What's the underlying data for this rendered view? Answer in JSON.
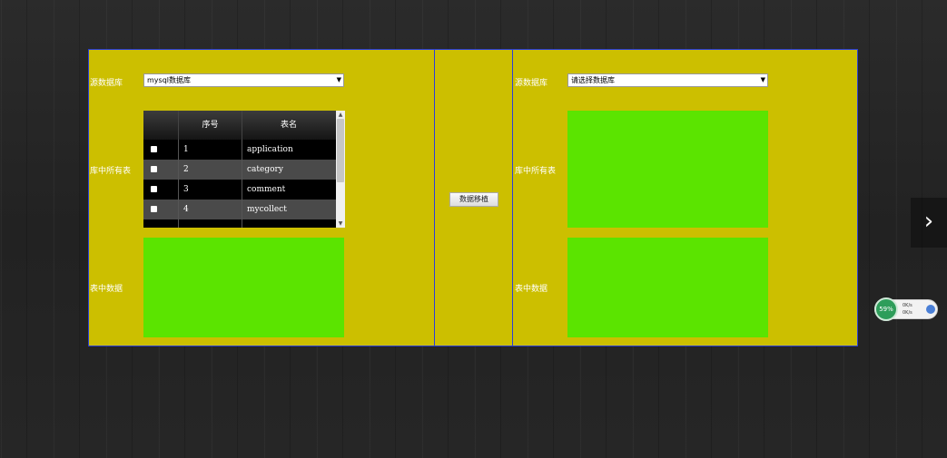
{
  "left": {
    "source_db_label": "源数据库",
    "source_db_value": "mysql数据库",
    "tables_label": "库中所有表",
    "data_label": "表中数据",
    "table": {
      "headers": [
        "",
        "序号",
        "表名"
      ],
      "rows": [
        {
          "num": "1",
          "name": "application"
        },
        {
          "num": "2",
          "name": "category"
        },
        {
          "num": "3",
          "name": "comment"
        },
        {
          "num": "4",
          "name": "mycollect"
        }
      ]
    }
  },
  "middle": {
    "migrate_button": "数据移植"
  },
  "right": {
    "target_db_label": "源数据库",
    "target_db_value": "请选择数据库",
    "tables_label": "库中所有表",
    "data_label": "表中数据"
  },
  "overlay": {
    "next_arrow": "›",
    "widget_percent": "59%",
    "widget_up": "0K/s",
    "widget_down": "0K/s"
  },
  "icons": [
    "chevron-right-icon",
    "dropdown-arrow-icon",
    "checkbox-icon"
  ],
  "colors": {
    "panel_bg": "#ccbf00",
    "panel_border": "#2a3fd8",
    "green_box": "#5be400"
  }
}
